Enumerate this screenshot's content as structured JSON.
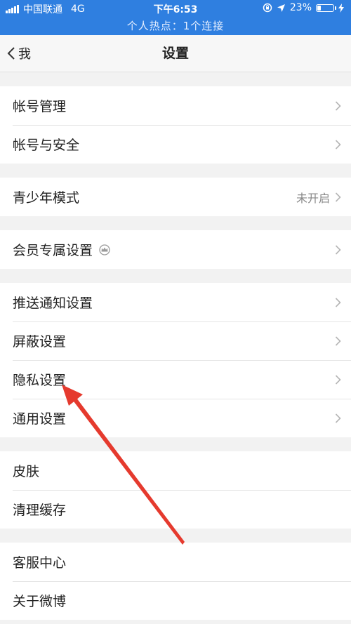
{
  "status_bar": {
    "carrier": "中国联通",
    "network": "4G",
    "time": "下午6:53",
    "battery_percent": "23%",
    "battery_level": 0.23,
    "hotspot_text": "个人热点：1个连接",
    "bar_color": "#2f7fe0"
  },
  "nav": {
    "back_label": "我",
    "title": "设置"
  },
  "groups": [
    {
      "items": [
        {
          "label": "帐号管理"
        },
        {
          "label": "帐号与安全"
        }
      ]
    },
    {
      "items": [
        {
          "label": "青少年模式",
          "status": "未开启"
        }
      ]
    },
    {
      "items": [
        {
          "label": "会员专属设置",
          "icon": "crown-icon"
        }
      ]
    },
    {
      "items": [
        {
          "label": "推送通知设置"
        },
        {
          "label": "屏蔽设置"
        },
        {
          "label": "隐私设置"
        },
        {
          "label": "通用设置"
        }
      ]
    },
    {
      "items": [
        {
          "label": "皮肤"
        },
        {
          "label": "清理缓存"
        }
      ]
    },
    {
      "items": [
        {
          "label": "客服中心"
        },
        {
          "label": "关于微博"
        }
      ]
    }
  ],
  "annotation": {
    "color": "#e53a2e",
    "points_to": "隐私设置"
  }
}
